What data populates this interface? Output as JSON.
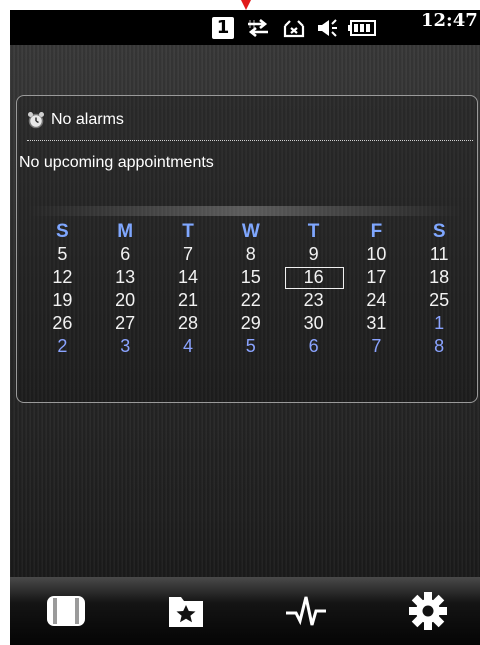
{
  "status_bar": {
    "sim_badge": "1",
    "time": "12:47",
    "icons": [
      "sync-arrows-icon",
      "inbox-icon",
      "speaker-icon",
      "battery-icon"
    ]
  },
  "today": {
    "alarm_text": "No alarms",
    "appointments_text": "No upcoming appointments"
  },
  "calendar": {
    "weekdays": [
      "S",
      "M",
      "T",
      "W",
      "T",
      "F",
      "S"
    ],
    "weeks": [
      [
        "5",
        "6",
        "7",
        "8",
        "9",
        "10",
        "11"
      ],
      [
        "12",
        "13",
        "14",
        "15",
        "16",
        "17",
        "18"
      ],
      [
        "19",
        "20",
        "21",
        "22",
        "23",
        "24",
        "25"
      ],
      [
        "26",
        "27",
        "28",
        "29",
        "30",
        "31",
        "1"
      ],
      [
        "2",
        "3",
        "4",
        "5",
        "6",
        "7",
        "8"
      ]
    ],
    "selected_day": "16",
    "next_month_color": "#8aa3ff",
    "weekday_color": "#7fa7ff"
  },
  "bottom_bar": {
    "buttons": [
      "cards-icon",
      "favorites-icon",
      "pulse-icon",
      "settings-gear-icon"
    ]
  }
}
